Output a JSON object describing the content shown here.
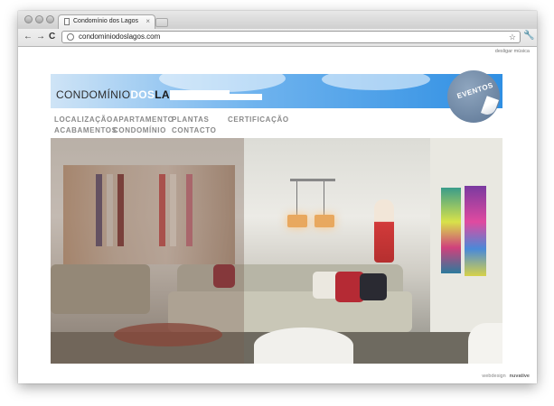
{
  "browser": {
    "tab_title": "Condomínio dos Lagos",
    "tab_close": "×",
    "url": "condominiodoslagos.com",
    "back": "←",
    "forward": "→",
    "reload": "C",
    "star": "☆",
    "wrench": "🔧"
  },
  "page": {
    "music_link": "desligar música",
    "logo": {
      "part1": "CONDOMÍNIO",
      "part2": "DOS",
      "part3": "LAGOS"
    },
    "eventos_label": "EVENTOS",
    "menu": [
      "LOCALIZAÇÃO",
      "APARTAMENTO",
      "PLANTAS",
      "CERTIFICAÇÃO",
      "ACABAMENTOS",
      "CONDOMÍNIO",
      "CONTACTO"
    ],
    "footer": {
      "credit": "webdesign",
      "brand": "nuvative"
    }
  }
}
